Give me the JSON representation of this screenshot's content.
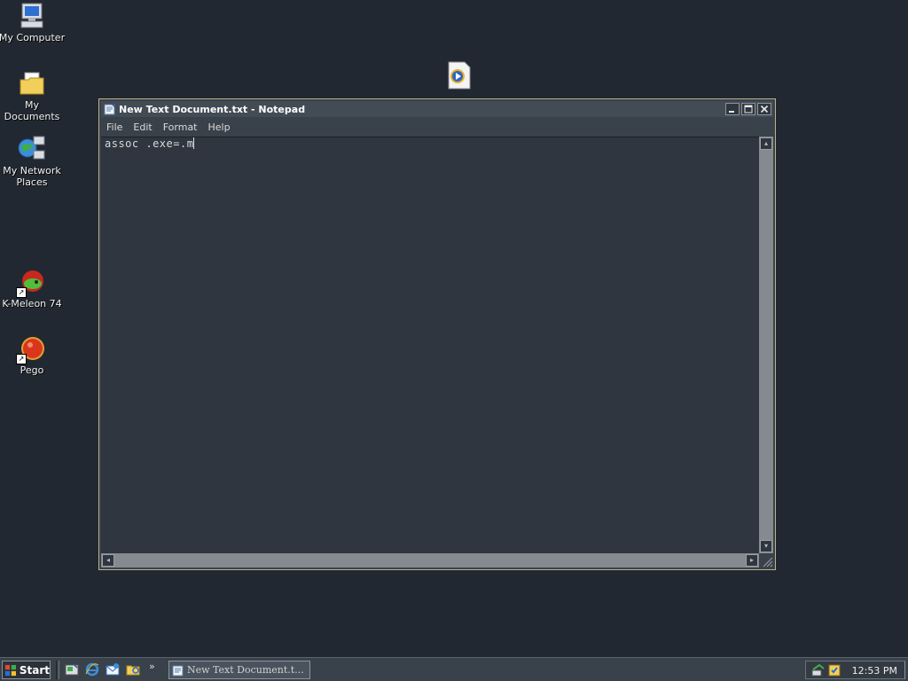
{
  "desktop": {
    "icons": [
      {
        "label": "My Computer"
      },
      {
        "label": "My Documents"
      },
      {
        "label": "My Network Places"
      },
      {
        "label": "K-Meleon 74"
      },
      {
        "label": "Pego"
      }
    ]
  },
  "window": {
    "title": "New Text Document.txt - Notepad",
    "menu": [
      "File",
      "Edit",
      "Format",
      "Help"
    ],
    "content": "assoc .exe=.m"
  },
  "taskbar": {
    "start_label": "Start",
    "quick_launch_icons": [
      "show-desktop-icon",
      "internet-explorer-icon",
      "outlook-express-icon",
      "explorer-icon"
    ],
    "more_label": "»",
    "task_button_label": "New Text Document.t...",
    "clock": "12:53 PM"
  },
  "colors": {
    "desktop_bg": "#222831",
    "window_bg": "#39414a",
    "editor_bg": "#2f363f",
    "window_border": "#b8b48a"
  }
}
